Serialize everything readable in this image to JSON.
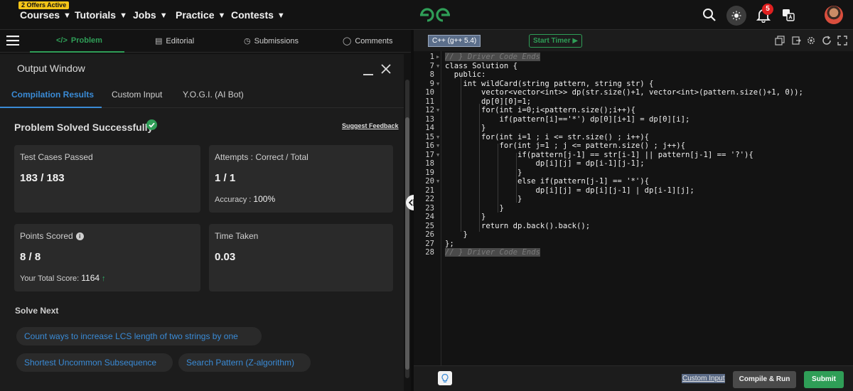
{
  "nav": {
    "offers_badge": "2 Offers Active",
    "items": [
      {
        "label": "Courses"
      },
      {
        "label": "Tutorials"
      },
      {
        "label": "Jobs"
      },
      {
        "label": "Practice"
      },
      {
        "label": "Contests"
      }
    ],
    "notification_count": "5",
    "brand_color": "#2f9e57"
  },
  "left_tabs": {
    "problem": "Problem",
    "editorial": "Editorial",
    "submissions": "Submissions",
    "comments": "Comments"
  },
  "output_window": {
    "title": "Output Window",
    "tabs": [
      "Compilation Results",
      "Custom Input",
      "Y.O.G.I. (AI Bot)"
    ],
    "status": "Problem Solved Successfully",
    "suggest_feedback": "Suggest Feedback",
    "cards": {
      "tests_label": "Test Cases Passed",
      "tests_value": "183 / 183",
      "attempts_label": "Attempts : Correct / Total",
      "attempts_value": "1 / 1",
      "accuracy_label": "Accuracy :",
      "accuracy_value": "100%",
      "points_label": "Points Scored",
      "points_value": "8 / 8",
      "total_label": "Your Total Score:",
      "total_value": "1164",
      "time_label": "Time Taken",
      "time_value": "0.03"
    },
    "solve_next_title": "Solve Next",
    "solve_next": [
      "Count ways to increase LCS length of two strings by one",
      "Shortest Uncommon Subsequence",
      "Search Pattern (Z-algorithm)"
    ]
  },
  "editor": {
    "language": "C++ (g++ 5.4)",
    "start_timer": "Start Timer",
    "custom_input": "Custom Input",
    "compile_run": "Compile & Run",
    "submit": "Submit",
    "lines": [
      {
        "n": "1",
        "text": "// } Driver Code Ends"
      },
      {
        "n": "7",
        "text": "class Solution {"
      },
      {
        "n": "8",
        "text": "  public:"
      },
      {
        "n": "9",
        "text": "    int wildCard(string pattern, string str) {"
      },
      {
        "n": "10",
        "text": "        vector<vector<int>> dp(str.size()+1, vector<int>(pattern.size()+1, 0));"
      },
      {
        "n": "11",
        "text": "        dp[0][0]=1;"
      },
      {
        "n": "12",
        "text": "        for(int i=0;i<pattern.size();i++){"
      },
      {
        "n": "13",
        "text": "            if(pattern[i]=='*') dp[0][i+1] = dp[0][i];"
      },
      {
        "n": "14",
        "text": "        }"
      },
      {
        "n": "15",
        "text": "        for(int i=1 ; i <= str.size() ; i++){"
      },
      {
        "n": "16",
        "text": "            for(int j=1 ; j <= pattern.size() ; j++){"
      },
      {
        "n": "17",
        "text": "                if(pattern[j-1] == str[i-1] || pattern[j-1] == '?'){"
      },
      {
        "n": "18",
        "text": "                    dp[i][j] = dp[i-1][j-1];"
      },
      {
        "n": "19",
        "text": "                }"
      },
      {
        "n": "20",
        "text": "                else if(pattern[j-1] == '*'){"
      },
      {
        "n": "21",
        "text": "                    dp[i][j] = dp[i][j-1] | dp[i-1][j];"
      },
      {
        "n": "22",
        "text": "                }"
      },
      {
        "n": "23",
        "text": "            }"
      },
      {
        "n": "24",
        "text": "        }"
      },
      {
        "n": "25",
        "text": "        return dp.back().back();"
      },
      {
        "n": "26",
        "text": "    }"
      },
      {
        "n": "27",
        "text": "};"
      },
      {
        "n": "28",
        "text": "// } Driver Code Ends"
      }
    ]
  }
}
